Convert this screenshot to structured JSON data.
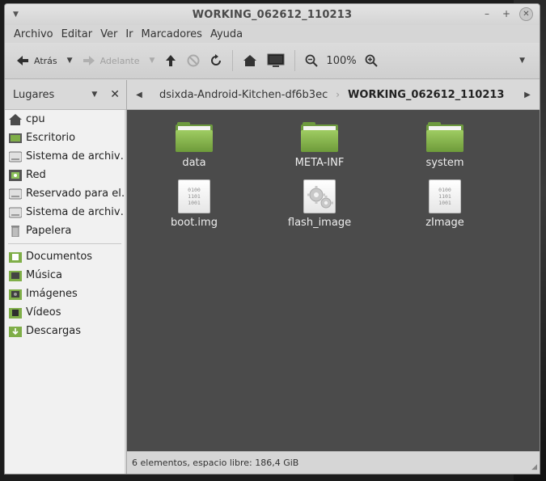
{
  "window": {
    "title": "WORKING_062612_110213"
  },
  "menubar": {
    "items": [
      "Archivo",
      "Editar",
      "Ver",
      "Ir",
      "Marcadores",
      "Ayuda"
    ]
  },
  "toolbar": {
    "back_label": "Atrás",
    "forward_label": "Adelante",
    "zoom": "100%"
  },
  "sidebar": {
    "header": "Lugares",
    "places": [
      {
        "label": "cpu",
        "icon": "home-icon"
      },
      {
        "label": "Escritorio",
        "icon": "desktop-icon"
      },
      {
        "label": "Sistema de archiv…",
        "icon": "drive-icon"
      },
      {
        "label": "Red",
        "icon": "network-icon"
      },
      {
        "label": "Reservado para el…",
        "icon": "drive-icon"
      },
      {
        "label": "Sistema de archiv…",
        "icon": "drive-icon"
      },
      {
        "label": "Papelera",
        "icon": "trash-icon"
      }
    ],
    "bookmarks": [
      {
        "label": "Documentos",
        "icon": "documents-folder-icon"
      },
      {
        "label": "Música",
        "icon": "music-folder-icon"
      },
      {
        "label": "Imágenes",
        "icon": "pictures-folder-icon"
      },
      {
        "label": "Vídeos",
        "icon": "videos-folder-icon"
      },
      {
        "label": "Descargas",
        "icon": "downloads-folder-icon"
      }
    ]
  },
  "pathbar": {
    "crumbs": [
      "dsixda-Android-Kitchen-df6b3ec",
      "WORKING_062612_110213"
    ]
  },
  "files": [
    {
      "name": "data",
      "type": "folder"
    },
    {
      "name": "META-INF",
      "type": "folder"
    },
    {
      "name": "system",
      "type": "folder"
    },
    {
      "name": "boot.img",
      "type": "binary"
    },
    {
      "name": "flash_image",
      "type": "executable"
    },
    {
      "name": "zImage",
      "type": "binary"
    }
  ],
  "binary_icon_text": [
    "0100",
    "1101",
    "1001"
  ],
  "status": {
    "text": "6 elementos, espacio libre: 186,4 GiB"
  },
  "colors": {
    "content_bg": "#4b4b4b",
    "folder_green": "#8fbf55"
  }
}
